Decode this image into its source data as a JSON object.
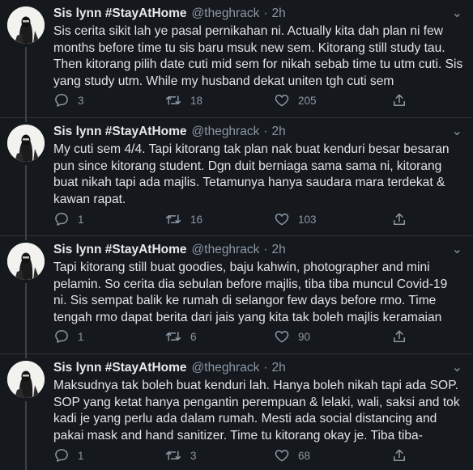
{
  "tweets": [
    {
      "name": "Sis lynn #StayAtHome",
      "handle": "@theghrack",
      "time": "2h",
      "text": "Sis cerita sikit lah ye pasal pernikahan ni. Actually kita dah plan ni few months before time tu sis baru msuk new sem. Kitorang still study tau. Then kitorang pilih date cuti mid sem for nikah sebab time tu utm cuti. Sis yang study utm. While my husband dekat uniten tgh cuti sem",
      "replies": "3",
      "retweets": "18",
      "likes": "205"
    },
    {
      "name": "Sis lynn #StayAtHome",
      "handle": "@theghrack",
      "time": "2h",
      "text": "My cuti sem 4/4. Tapi kitorang tak plan nak buat kenduri besar besaran pun since kitorang student. Dgn duit berniaga sama sama ni, kitorang buat nikah tapi ada majlis. Tetamunya hanya saudara mara terdekat & kawan rapat.",
      "replies": "1",
      "retweets": "16",
      "likes": "103"
    },
    {
      "name": "Sis lynn #StayAtHome",
      "handle": "@theghrack",
      "time": "2h",
      "text": "Tapi kitorang still buat goodies, baju kahwin, photographer and mini pelamin. So cerita dia sebulan before majlis, tiba tiba muncul Covid-19 ni. Sis sempat balik ke rumah di selangor few days before rmo. Time tengah rmo dapat berita dari jais yang kita tak boleh majlis keramaian",
      "replies": "1",
      "retweets": "6",
      "likes": "90"
    },
    {
      "name": "Sis lynn #StayAtHome",
      "handle": "@theghrack",
      "time": "2h",
      "text": "Maksudnya tak boleh buat kenduri lah. Hanya boleh nikah tapi ada SOP. SOP yang ketat hanya pengantin perempuan & lelaki, wali, saksi and tok kadi je yang perlu ada dalam rumah. Mesti ada social distancing and pakai mask and hand sanitizer. Time tu kitorang okay je. Tiba tiba-",
      "replies": "1",
      "retweets": "3",
      "likes": "68"
    }
  ],
  "icons": {
    "reply": "comment-icon",
    "retweet": "retweet-icon",
    "like": "heart-icon",
    "share": "share-icon",
    "more": "more-options-icon"
  },
  "colors": {
    "background": "#15181c",
    "text": "#e1e4e6",
    "muted": "#8b98a5",
    "divider": "#2f3336"
  }
}
